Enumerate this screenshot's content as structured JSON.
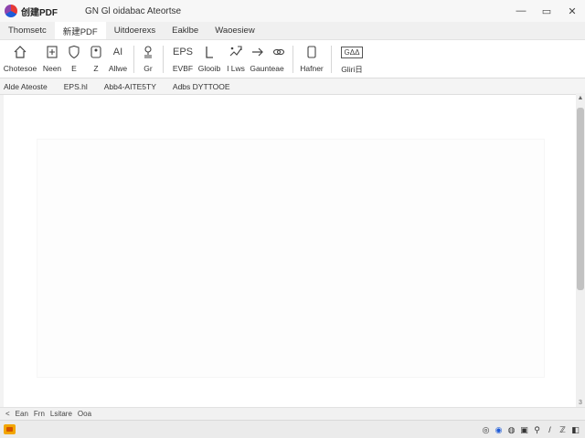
{
  "app": {
    "name": "PDF"
  },
  "window": {
    "title": "GN  Gl  oidabac Ateortse",
    "minimize_icon": "minimize-icon",
    "maximize_icon": "maximize-icon",
    "close_icon": "close-icon"
  },
  "menu": {
    "tabs": [
      {
        "label": "Thomsetc",
        "active": false
      },
      {
        "label": "新建PDF",
        "active": true
      },
      {
        "label": "Uitdoerexs",
        "active": false
      },
      {
        "label": "Eaklbe",
        "active": false
      },
      {
        "label": "Waoesiew",
        "active": false
      }
    ]
  },
  "ribbon": {
    "tools": [
      {
        "label": "Chotesoe",
        "icon": "home-icon"
      },
      {
        "label": "Neen",
        "icon": "add-page-icon"
      },
      {
        "label": "E",
        "icon": "shield-icon"
      },
      {
        "label": "Z",
        "icon": "page-icon"
      },
      {
        "label": "Allwe",
        "icon": "ai-icon",
        "icon_text": "AI"
      },
      {
        "label": "Gr",
        "icon": "stamp-icon"
      },
      {
        "label": "EVBF",
        "icon": "eps-icon",
        "icon_text": "EPS"
      },
      {
        "label": "Glooib",
        "icon": "bracket-icon"
      },
      {
        "label": "I Lws",
        "icon": "edit-image-icon"
      },
      {
        "label": "Gaunteae",
        "icon": "arrow-right-icon"
      },
      {
        "label": "",
        "icon": "link-icon"
      },
      {
        "label": "Hafner",
        "icon": "document-icon"
      },
      {
        "label": "Gliri日",
        "icon": "ocr-icon",
        "icon_text": "GΔΔ"
      }
    ]
  },
  "subbar": {
    "items": [
      "Alde Ateoste",
      "EPS.hl",
      "Abb4-AITE5TY",
      "Adbs DYTTOOE"
    ]
  },
  "statusbar": {
    "items": [
      "<",
      "Ean",
      "Frn",
      "Lsitare",
      "Ooa"
    ]
  },
  "scrollbar": {
    "up_icon": "scroll-up-icon",
    "down_icon": "scroll-down-icon",
    "corner_label": "3"
  },
  "taskbar": {
    "tray": [
      {
        "icon": "network-icon",
        "glyph": "◎"
      },
      {
        "icon": "blue-circle-icon",
        "glyph": "◉"
      },
      {
        "icon": "chat-icon",
        "glyph": "◍"
      },
      {
        "icon": "image-icon",
        "glyph": "▣"
      },
      {
        "icon": "mic-icon",
        "glyph": "⚲"
      },
      {
        "icon": "pen-icon",
        "glyph": "/"
      },
      {
        "icon": "text-icon",
        "glyph": "ℤ"
      },
      {
        "icon": "speaker-icon",
        "glyph": "◧"
      }
    ]
  }
}
